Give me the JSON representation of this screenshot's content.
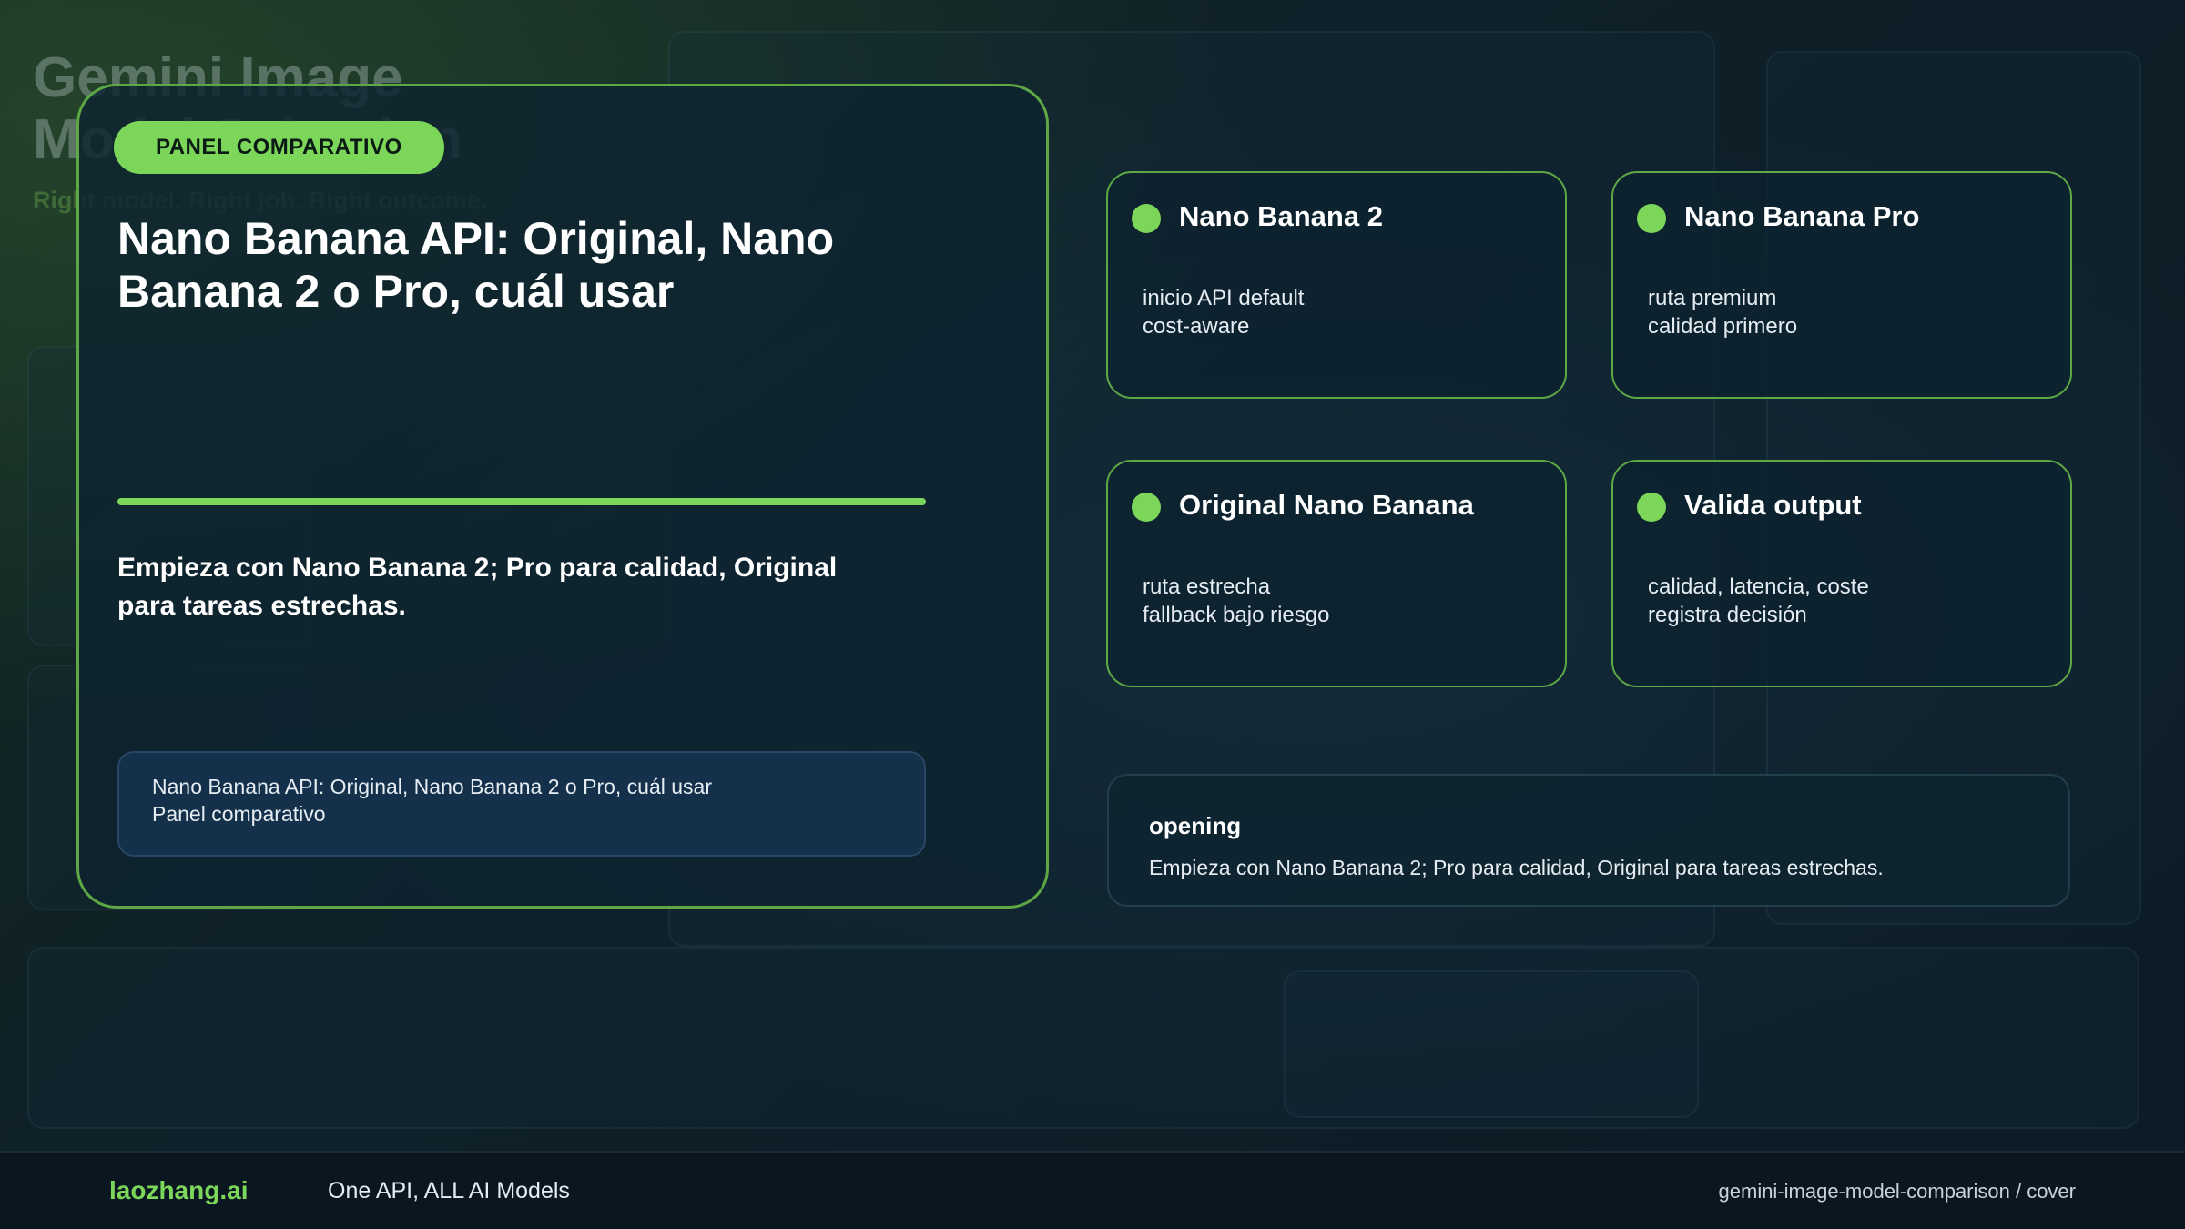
{
  "colors": {
    "accent": "#7bd65a",
    "panel_border": "#5da845",
    "background": "#0b1a22"
  },
  "main": {
    "badge": "PANEL COMPARATIVO",
    "title": "Nano Banana API: Original, Nano Banana 2 o Pro, cuál usar",
    "subtitle": "Empieza con Nano Banana 2; Pro para calidad, Original para tareas estrechas.",
    "meta": {
      "line1": "Nano Banana API: Original, Nano Banana 2 o Pro, cuál usar",
      "line2": "Panel comparativo"
    }
  },
  "cards": [
    {
      "title": "Nano Banana 2",
      "lines": [
        "inicio API default",
        "cost-aware"
      ]
    },
    {
      "title": "Nano Banana Pro",
      "lines": [
        "ruta premium",
        "calidad primero"
      ]
    },
    {
      "title": "Original Nano Banana",
      "lines": [
        "ruta estrecha",
        "fallback bajo riesgo"
      ]
    },
    {
      "title": "Valida output",
      "lines": [
        "calidad, latencia, coste",
        "registra decisión"
      ]
    }
  ],
  "opening": {
    "title": "opening",
    "text": "Empieza con Nano Banana 2; Pro para calidad, Original para tareas estrechas."
  },
  "footer": {
    "brand": "laozhang.ai",
    "tagline": "One API, ALL AI Models",
    "path": "gemini-image-model-comparison / cover"
  }
}
